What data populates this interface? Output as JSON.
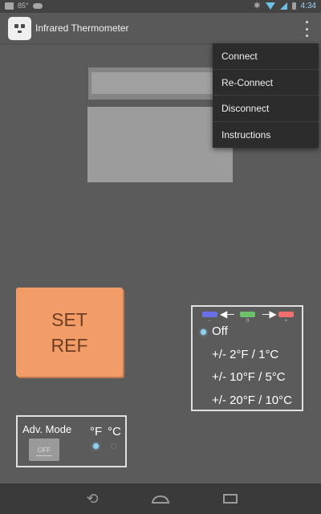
{
  "status_bar": {
    "temperature": "85°",
    "time": "4:34",
    "icons": [
      "image-icon",
      "weather-icon",
      "bluetooth-icon",
      "wifi-icon",
      "signal-icon",
      "battery-icon"
    ]
  },
  "app": {
    "title": "Infrared Thermometer",
    "icon": "app-icon"
  },
  "menu": {
    "items": [
      {
        "label": "Connect"
      },
      {
        "label": "Re-Connect"
      },
      {
        "label": "Disconnect"
      },
      {
        "label": "Instructions"
      }
    ]
  },
  "main": {
    "set_ref": {
      "line1": "SET",
      "line2": "REF"
    },
    "tolerance": {
      "legend": {
        "minus": "-",
        "zero": "0",
        "plus": "+"
      },
      "options": [
        {
          "label": "Off",
          "selected": true
        },
        {
          "label": "+/- 2°F / 1°C",
          "selected": false
        },
        {
          "label": "+/- 10°F / 5°C",
          "selected": false
        },
        {
          "label": "+/- 20°F / 10°C",
          "selected": false
        }
      ]
    },
    "advanced": {
      "label": "Adv. Mode",
      "toggle_state": "OFF",
      "unit_f": "°F",
      "unit_c": "°C",
      "selected_unit": "F"
    }
  },
  "colors": {
    "set_ref": "#f29c68",
    "legend_minus": "#6a6fe8",
    "legend_zero": "#6cc26b",
    "legend_plus": "#f36f6f",
    "accent": "#8fd0ee"
  },
  "nav": {
    "icons": [
      "back-icon",
      "home-icon",
      "recents-icon"
    ]
  }
}
